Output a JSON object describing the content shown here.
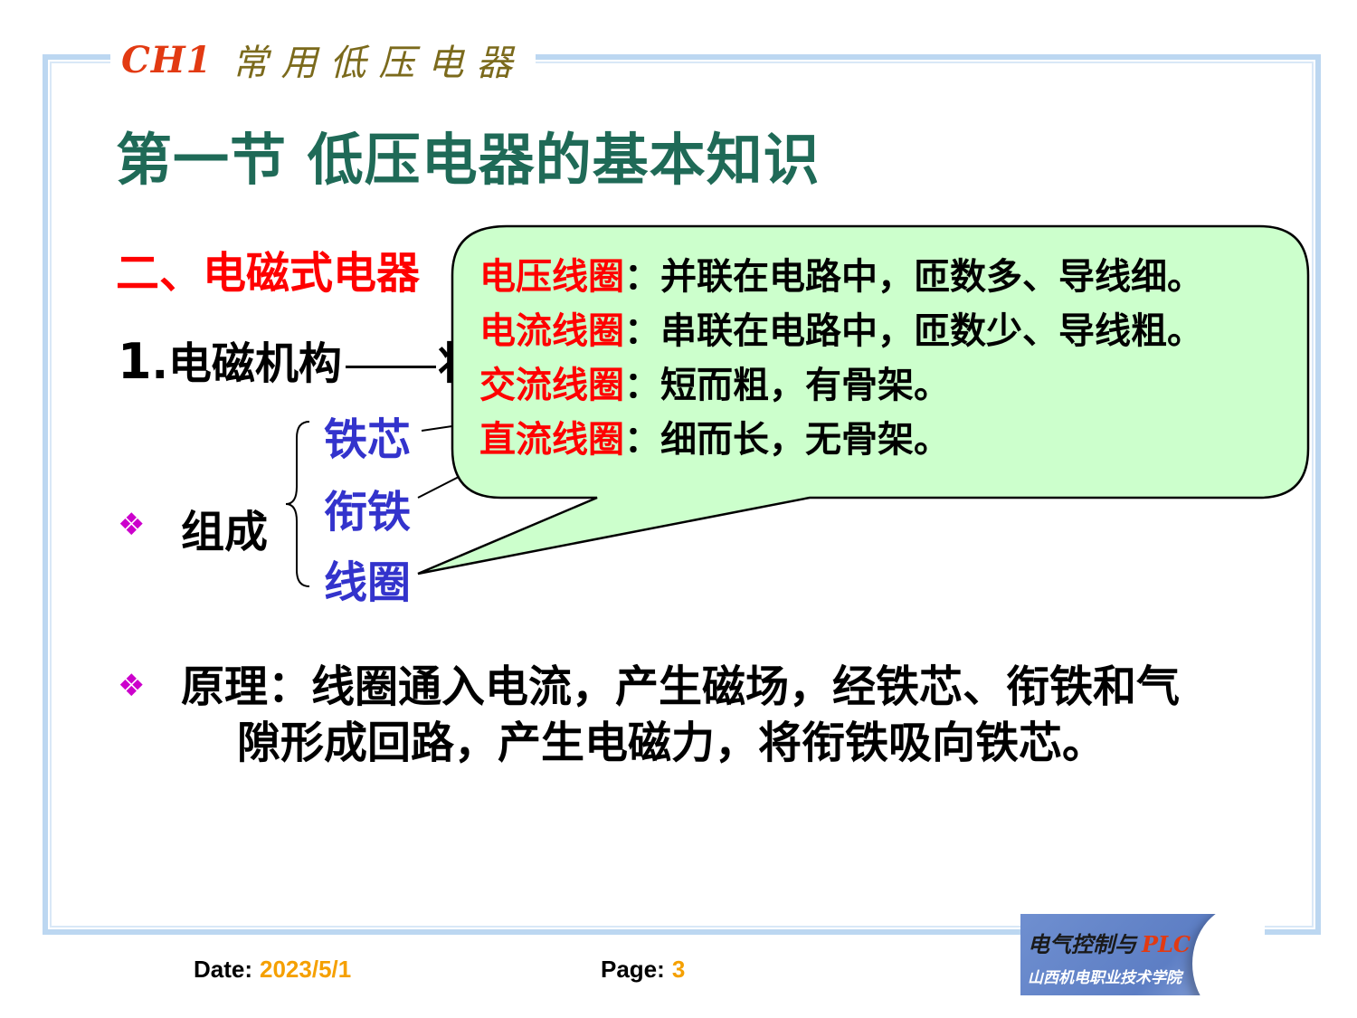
{
  "header": {
    "chapter_code": "CH1",
    "chapter_name": "常用低压电器"
  },
  "section_title": "第一节  低压电器的基本知识",
  "subheading": "二、电磁式电器",
  "mechanism": {
    "number": "1",
    "label": ".电磁机构",
    "tail": "将"
  },
  "composition": {
    "label": "组成",
    "parts": [
      "铁芯",
      "衔铁",
      "线圈"
    ]
  },
  "callout": {
    "lines": [
      {
        "term": "电压线圈",
        "desc": "：并联在电路中，匝数多、导线细。"
      },
      {
        "term": "电流线圈",
        "desc": "：串联在电路中，匝数少、导线粗。"
      },
      {
        "term": "交流线圈",
        "desc": "：短而粗，有骨架。"
      },
      {
        "term": "直流线圈",
        "desc": "：细而长，无骨架。"
      }
    ]
  },
  "principle": {
    "line1": "原理：线圈通入电流，产生磁场，经铁芯、衔铁和气",
    "line2": "隙形成回路，产生电磁力，将衔铁吸向铁芯。"
  },
  "footer": {
    "date_label": "Date:",
    "date_value": "2023/5/1",
    "page_label": "Page:",
    "page_value": "3"
  },
  "logo": {
    "line1_cn": "电气控制与",
    "line1_plc": "PLC",
    "line2": "山西机电职业技术学院"
  },
  "colors": {
    "title_green": "#1f6a57",
    "heading_red": "#ff0000",
    "part_blue": "#3333cc",
    "bullet_magenta": "#cc00cc",
    "callout_fill": "#ccffcc",
    "footer_value": "#f5a000"
  },
  "icons": {
    "bullet": "diamond-bullet-icon",
    "brace": "left-brace-icon"
  }
}
